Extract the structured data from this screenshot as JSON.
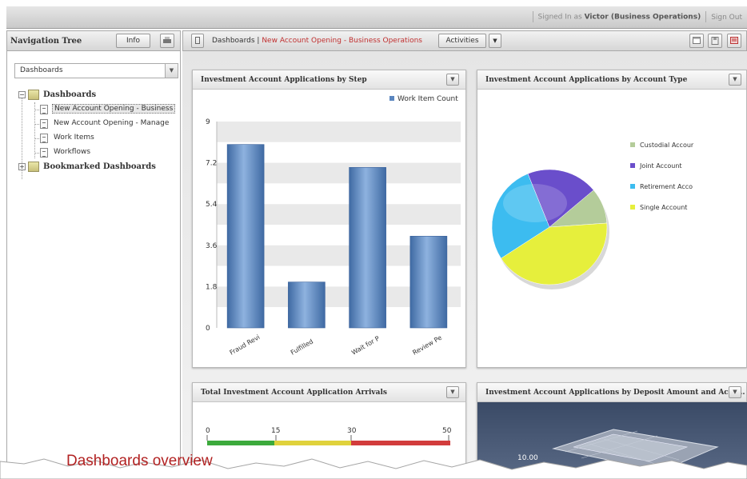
{
  "header": {
    "signed_in": "Signed In as",
    "user": "Victor (Business Operations)",
    "sign_out": "Sign Out"
  },
  "nav": {
    "title": "Navigation Tree",
    "info_button": "Info",
    "select_value": "Dashboards",
    "tree": {
      "root_label": "Dashboards",
      "items": [
        {
          "label": "New Account Opening - Business",
          "selected": true
        },
        {
          "label": "New Account Opening - Manage",
          "selected": false
        },
        {
          "label": "Work Items",
          "selected": false
        },
        {
          "label": "Workflows",
          "selected": false
        }
      ],
      "bookmarked_label": "Bookmarked Dashboards"
    }
  },
  "breadcrumb": {
    "root": "Dashboards",
    "separator": "|",
    "current": "New Account Opening - Business Operations",
    "activities_label": "Activities"
  },
  "panels": {
    "by_step": {
      "title": "Investment Account Applications by Step",
      "legend": "Work Item Count"
    },
    "by_type": {
      "title": "Investment Account Applications by Account Type",
      "legend": [
        "Custodial Accour",
        "Joint Account",
        "Retirement Acco",
        "Single Account"
      ]
    },
    "arrivals": {
      "title": "Total Investment Account Application Arrivals",
      "scale_labels": [
        "0",
        "15",
        "30",
        "50"
      ]
    },
    "by_deposit": {
      "title": "Investment Account Applications by Deposit Amount and Acco...",
      "value_label": "10.00"
    }
  },
  "colors": {
    "bar": "#5a86bf",
    "pie": [
      "#b4cc9a",
      "#6a4ecb",
      "#3cbcf0",
      "#e6ef3c"
    ],
    "gauge": [
      "#3caa3c",
      "#e0d23c",
      "#d23c3c"
    ]
  },
  "chart_data": [
    {
      "type": "bar",
      "title": "Investment Account Applications by Step",
      "categories": [
        "Fraud Revi",
        "Fulfilled",
        "Wait for P",
        "Review Pe"
      ],
      "series": [
        {
          "name": "Work Item Count",
          "values": [
            8,
            2,
            7,
            4
          ]
        }
      ],
      "y_ticks": [
        "9",
        "7.2",
        "5.4",
        "3.6",
        "1.8",
        "0"
      ],
      "ylim": [
        0,
        9
      ],
      "grid": true,
      "legend": "top-right"
    },
    {
      "type": "pie",
      "title": "Investment Account Applications by Account Type",
      "labels": [
        "Custodial Accour",
        "Joint Account",
        "Retirement Acco",
        "Single Account"
      ],
      "values": [
        10,
        20,
        28,
        42
      ],
      "legend": "right"
    }
  ],
  "caption": "Dashboards overview"
}
